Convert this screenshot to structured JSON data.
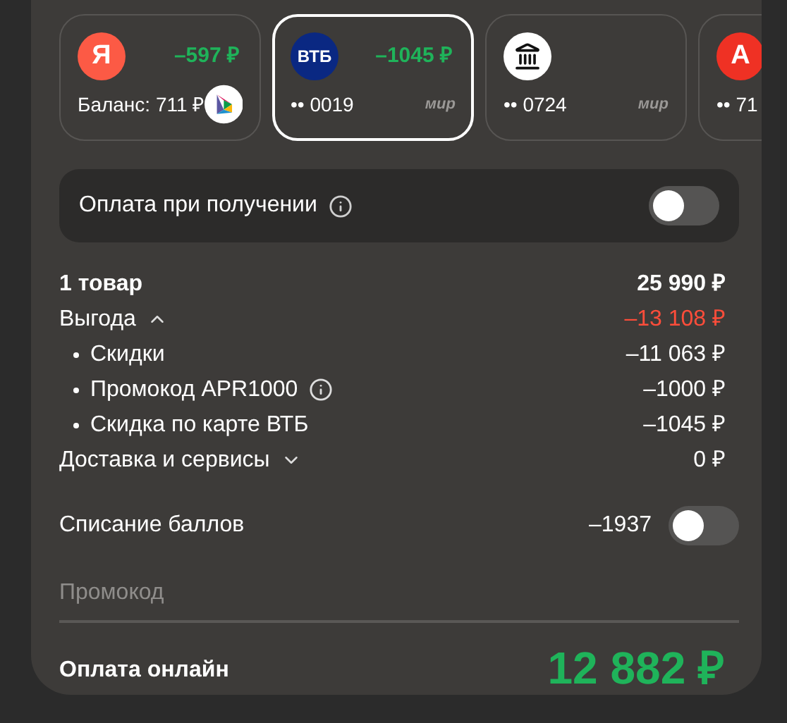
{
  "cards": [
    {
      "logo": {
        "kind": "letter",
        "text": "Я",
        "color": "#fc5a45"
      },
      "cashback": "–597 ₽",
      "label": "Баланс: 711 ₽",
      "network": {
        "kind": "sbp-icon"
      },
      "selected": false
    },
    {
      "logo": {
        "kind": "letter",
        "text": "ВТБ",
        "color": "#0a2882"
      },
      "cashback": "–1045 ₽",
      "label": "•• 0019",
      "network": {
        "kind": "text",
        "text": "мир"
      },
      "selected": true
    },
    {
      "logo": {
        "kind": "bank-icon"
      },
      "label": "•• 0724",
      "network": {
        "kind": "text",
        "text": "мир"
      },
      "selected": false
    },
    {
      "logo": {
        "kind": "letter",
        "text": "А",
        "color": "#ef3124"
      },
      "label": "•• 71",
      "selected": false
    }
  ],
  "cash_on_delivery": {
    "label": "Оплата при получении",
    "on": false
  },
  "summary": [
    {
      "kind": "total",
      "label": "1 товар",
      "value": "25 990 ₽"
    },
    {
      "kind": "group",
      "label": "Выгода",
      "value": "–13 108 ₽",
      "expanded": true,
      "negative": true
    },
    {
      "kind": "sub",
      "label": "Скидки",
      "value": "–11 063 ₽"
    },
    {
      "kind": "sub",
      "label": "Промокод APR1000",
      "value": "–1000 ₽",
      "info": true
    },
    {
      "kind": "sub",
      "label": "Скидка по карте ВТБ",
      "value": "–1045 ₽"
    },
    {
      "kind": "group",
      "label": "Доставка и сервисы",
      "value": "0 ₽",
      "expanded": false
    }
  ],
  "points": {
    "label": "Списание баллов",
    "value": "–1937",
    "on": false
  },
  "promo": {
    "placeholder": "Промокод"
  },
  "total": {
    "label": "Оплата онлайн",
    "value": "12 882 ₽"
  }
}
